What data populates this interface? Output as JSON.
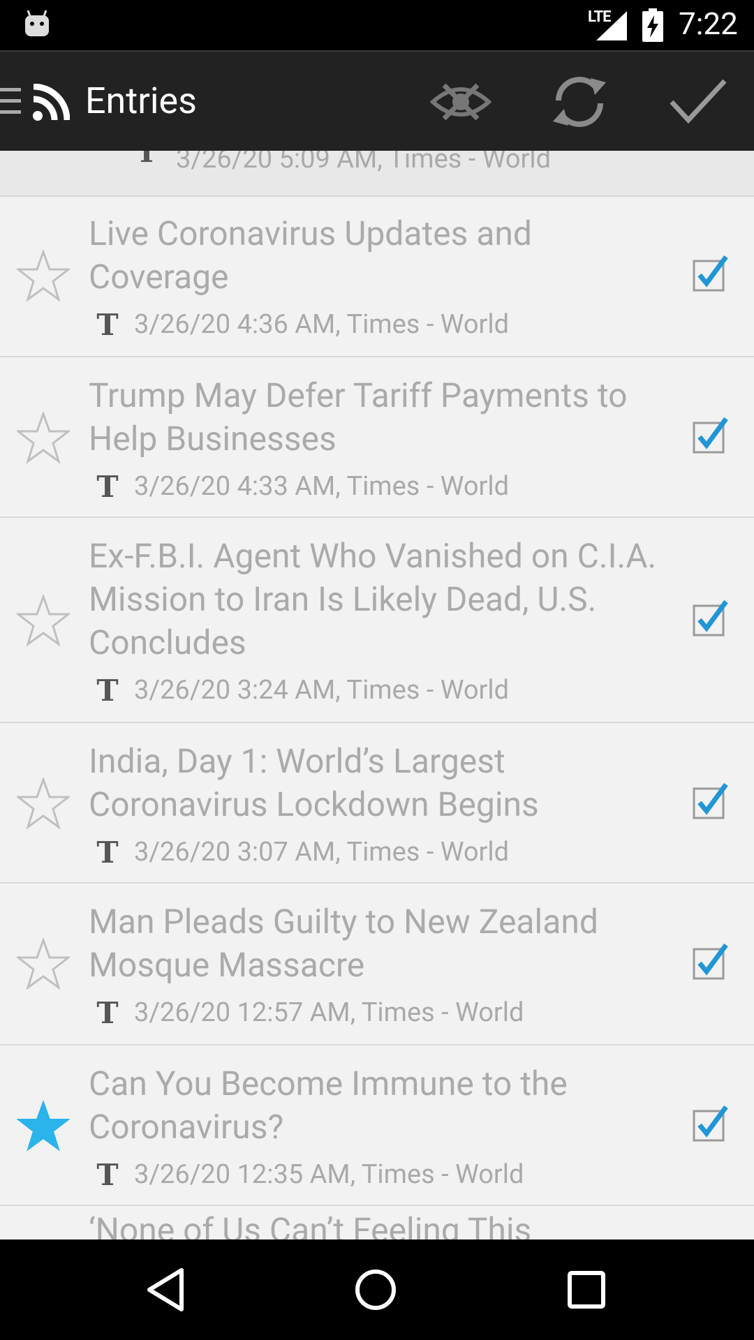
{
  "status_bar": {
    "network": "LTE",
    "time": "7:22"
  },
  "app_bar": {
    "title": "Entries"
  },
  "list": {
    "partial_top_meta": "3/26/20 5:09 AM, Times - World",
    "entries": [
      {
        "title": "Live Coronavirus Updates and Coverage",
        "meta": "3/26/20 4:36 AM, Times - World",
        "starred": false,
        "checked": true
      },
      {
        "title": "Trump May Defer Tariff Payments to Help Businesses",
        "meta": "3/26/20 4:33 AM, Times - World",
        "starred": false,
        "checked": true
      },
      {
        "title": "Ex-F.B.I. Agent Who Vanished on C.I.A. Mission to Iran Is Likely Dead, U.S. Concludes",
        "meta": "3/26/20 3:24 AM, Times - World",
        "starred": false,
        "checked": true
      },
      {
        "title": "India, Day 1: World’s Largest Coronavirus Lockdown Begins",
        "meta": "3/26/20 3:07 AM, Times - World",
        "starred": false,
        "checked": true
      },
      {
        "title": "Man Pleads Guilty to New Zealand Mosque Massacre",
        "meta": "3/26/20 12:57 AM, Times - World",
        "starred": false,
        "checked": true
      },
      {
        "title": "Can You Become Immune to the Coronavirus?",
        "meta": "3/26/20 12:35 AM, Times - World",
        "starred": true,
        "checked": true
      }
    ],
    "partial_bottom_title": "‘None of Us Can’t Feeling This"
  },
  "colors": {
    "star_active": "#2bb3ec",
    "check_mark": "#2196d6",
    "text_read": "#aaaaaa"
  }
}
